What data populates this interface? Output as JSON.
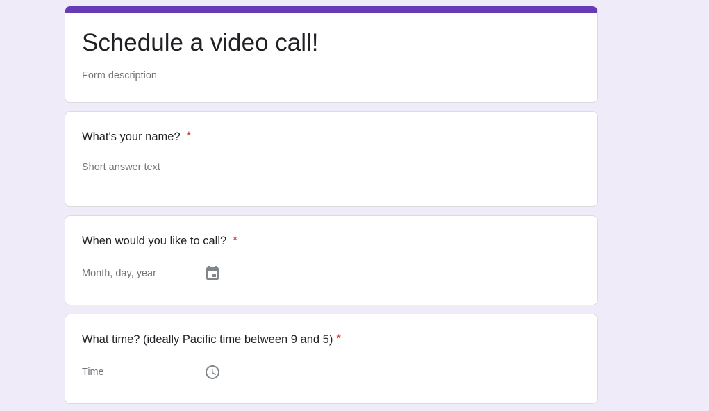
{
  "header": {
    "title": "Schedule a video call!",
    "description": "Form description"
  },
  "questions": [
    {
      "title": "What's your name?",
      "required_mark": "*",
      "answer_placeholder": "Short answer text",
      "type": "short-answer"
    },
    {
      "title": "When would you like to call?",
      "required_mark": "*",
      "answer_placeholder": "Month, day, year",
      "type": "date",
      "icon": "calendar-icon"
    },
    {
      "title": "What time? (ideally Pacific time between 9 and 5)",
      "required_mark": "*",
      "answer_placeholder": "Time",
      "type": "time",
      "icon": "clock-icon"
    }
  ],
  "colors": {
    "accent": "#673ab7",
    "background": "#f0ebf8",
    "required": "#d93025"
  }
}
